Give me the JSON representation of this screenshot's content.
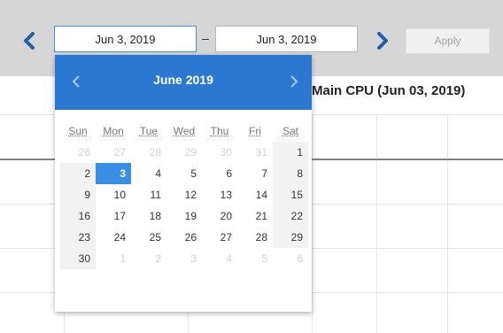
{
  "toolbar": {
    "start_date": "Jun 3, 2019",
    "end_date": "Jun 3, 2019",
    "separator": "–",
    "apply_label": "Apply",
    "prev_icon": "chevron-left-icon",
    "next_icon": "chevron-right-icon"
  },
  "chart": {
    "title": "Main CPU (Jun 03, 2019)",
    "line_color": "#8a7a90"
  },
  "calendar": {
    "title": "June 2019",
    "header_color": "#2a78d2",
    "selected_color": "#3a8ee6",
    "weekdays": [
      "Sun",
      "Mon",
      "Tue",
      "Wed",
      "Thu",
      "Fri",
      "Sat"
    ],
    "weeks": [
      [
        {
          "d": "26",
          "m": true
        },
        {
          "d": "27",
          "m": true
        },
        {
          "d": "28",
          "m": true
        },
        {
          "d": "29",
          "m": true
        },
        {
          "d": "30",
          "m": true
        },
        {
          "d": "31",
          "m": true
        },
        {
          "d": "1"
        }
      ],
      [
        {
          "d": "2"
        },
        {
          "d": "3",
          "sel": true
        },
        {
          "d": "4"
        },
        {
          "d": "5"
        },
        {
          "d": "6"
        },
        {
          "d": "7"
        },
        {
          "d": "8"
        }
      ],
      [
        {
          "d": "9"
        },
        {
          "d": "10"
        },
        {
          "d": "11"
        },
        {
          "d": "12"
        },
        {
          "d": "13"
        },
        {
          "d": "14"
        },
        {
          "d": "15"
        }
      ],
      [
        {
          "d": "16"
        },
        {
          "d": "17"
        },
        {
          "d": "18"
        },
        {
          "d": "19"
        },
        {
          "d": "20"
        },
        {
          "d": "21"
        },
        {
          "d": "22"
        }
      ],
      [
        {
          "d": "23"
        },
        {
          "d": "24"
        },
        {
          "d": "25"
        },
        {
          "d": "26"
        },
        {
          "d": "27"
        },
        {
          "d": "28"
        },
        {
          "d": "29"
        }
      ],
      [
        {
          "d": "30"
        },
        {
          "d": "1",
          "m": true
        },
        {
          "d": "2",
          "m": true
        },
        {
          "d": "3",
          "m": true
        },
        {
          "d": "4",
          "m": true
        },
        {
          "d": "5",
          "m": true
        },
        {
          "d": "6",
          "m": true
        }
      ]
    ]
  }
}
